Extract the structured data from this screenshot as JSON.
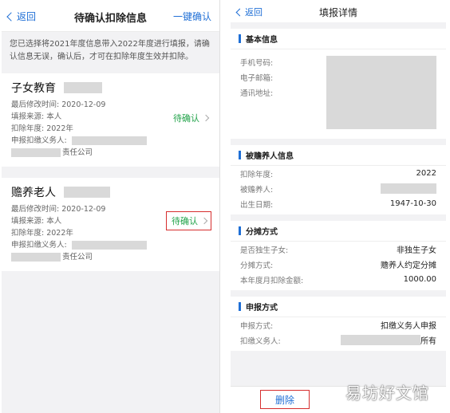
{
  "left": {
    "nav": {
      "back": "返回",
      "title": "待确认扣除信息",
      "action": "一键确认"
    },
    "notice": "您已选择将2021年度信息带入2022年度进行填报，请确认信息无误，确认后，才可在扣除年度生效并扣除。",
    "cards": [
      {
        "title": "子女教育",
        "modified": "最后修改时间: 2020-12-09",
        "source": "填报来源: 本人",
        "year": "扣除年度: 2022年",
        "agent_label": "申报扣缴义务人:",
        "company_suffix": "责任公司",
        "status": "待确认"
      },
      {
        "title": "赡养老人",
        "modified": "最后修改时间: 2020-12-09",
        "source": "填报来源: 本人",
        "year": "扣除年度: 2022年",
        "agent_label": "申报扣缴义务人:",
        "company_suffix": "责任公司",
        "status": "待确认"
      }
    ]
  },
  "right": {
    "nav": {
      "back": "返回",
      "title": "填报详情"
    },
    "basic": {
      "title": "基本信息",
      "phone": "手机号码:",
      "email": "电子邮箱:",
      "address": "通讯地址:"
    },
    "dependent": {
      "title": "被赡养人信息",
      "year_label": "扣除年度:",
      "year_value": "2022",
      "person_label": "被赡养人:",
      "birth_label": "出生日期:",
      "birth_value": "1947-10-30"
    },
    "split": {
      "title": "分摊方式",
      "only_label": "是否独生子女:",
      "only_value": "非独生子女",
      "method_label": "分摊方式:",
      "method_value": "赡养人约定分摊",
      "amount_label": "本年度月扣除金额:",
      "amount_value": "1000.00"
    },
    "declare": {
      "title": "申报方式",
      "method_label": "申报方式:",
      "method_value": "扣缴义务人申报",
      "agent_label": "扣缴义务人:",
      "agent_value": "所有"
    },
    "delete": "删除"
  },
  "watermark": "易坊好文馆",
  "colors": {
    "link": "#1f6fd6",
    "status": "#22a34a",
    "highlight": "#d62e2e"
  }
}
